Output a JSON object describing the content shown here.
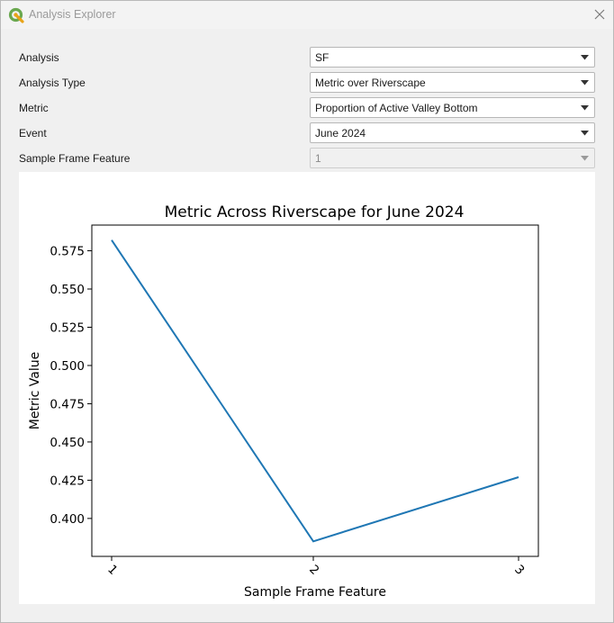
{
  "window": {
    "title": "Analysis Explorer",
    "app_icon": "qgis-logo-icon",
    "close_icon": "close-icon"
  },
  "form": {
    "rows": [
      {
        "label": "Analysis",
        "value": "SF",
        "enabled": true
      },
      {
        "label": "Analysis Type",
        "value": "Metric over Riverscape",
        "enabled": true
      },
      {
        "label": "Metric",
        "value": "Proportion of Active Valley Bottom",
        "enabled": true
      },
      {
        "label": "Event",
        "value": "June 2024",
        "enabled": true
      },
      {
        "label": "Sample Frame Feature",
        "value": "1",
        "enabled": false
      }
    ]
  },
  "colors": {
    "line": "#1f77b4",
    "window_bg": "#f0f0f0",
    "plot_bg": "#ffffff"
  },
  "chart_data": {
    "type": "line",
    "title": "Metric Across Riverscape for June 2024",
    "xlabel": "Sample Frame Feature",
    "ylabel": "Metric Value",
    "x": [
      "1",
      "2",
      "3"
    ],
    "series": [
      {
        "values": [
          0.582,
          0.385,
          0.427
        ]
      }
    ],
    "yticks": [
      "0.400",
      "0.425",
      "0.450",
      "0.475",
      "0.500",
      "0.525",
      "0.550",
      "0.575"
    ],
    "ylim": [
      0.3752,
      0.5918
    ],
    "x_tick_rotation_deg": 45,
    "grid": false,
    "legend": "none"
  }
}
